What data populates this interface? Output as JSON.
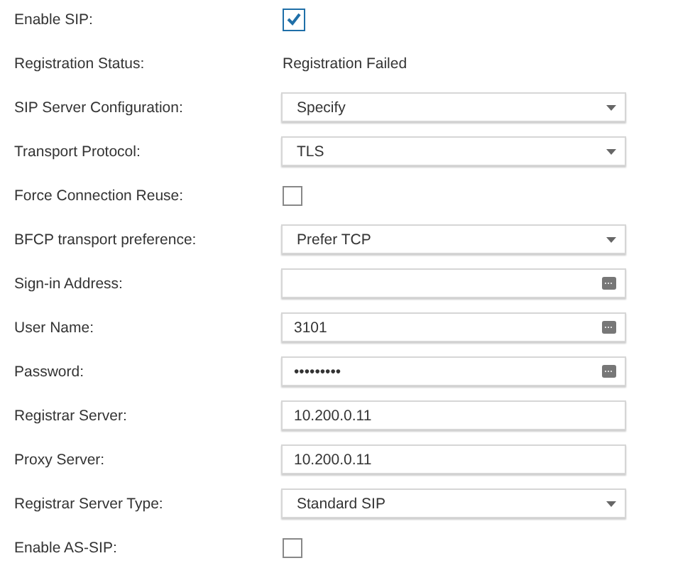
{
  "settings": [
    {
      "label": "Enable SIP:",
      "kind": "checkbox",
      "checked": true
    },
    {
      "label": "Registration Status:",
      "kind": "status",
      "value": "Registration Failed"
    },
    {
      "label": "SIP Server Configuration:",
      "kind": "select",
      "value": "Specify"
    },
    {
      "label": "Transport Protocol:",
      "kind": "select",
      "value": "TLS"
    },
    {
      "label": "Force Connection Reuse:",
      "kind": "checkbox",
      "checked": false
    },
    {
      "label": "BFCP transport preference:",
      "kind": "select",
      "value": "Prefer TCP"
    },
    {
      "label": "Sign-in Address:",
      "kind": "credential"
    },
    {
      "label": "User Name:",
      "kind": "credential",
      "value": "3101"
    },
    {
      "label": "Password:",
      "kind": "credential",
      "value": "•••••••••"
    },
    {
      "label": "Registrar Server:",
      "kind": "text",
      "value": "10.200.0.11"
    },
    {
      "label": "Proxy Server:",
      "kind": "text",
      "value": "10.200.0.11"
    },
    {
      "label": "Registrar Server Type:",
      "kind": "select",
      "value": "Standard SIP"
    },
    {
      "label": "Enable AS-SIP:",
      "kind": "checkbox",
      "checked": false
    }
  ]
}
